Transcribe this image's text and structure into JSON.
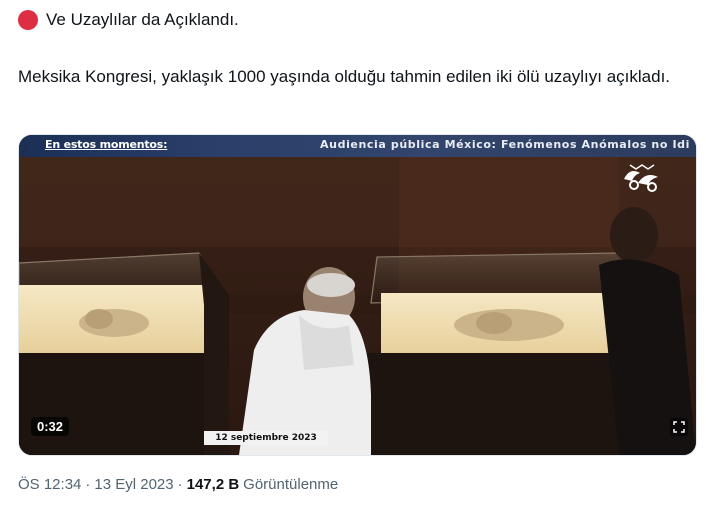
{
  "tweet": {
    "headline": "Ve Uzaylılar da Açıklandı.",
    "body": "Meksika Kongresi, yaklaşık 1000 yaşında olduğu tahmin edilen iki ölü uzaylıyı açıkladı.",
    "accent_color": "#dd2e44"
  },
  "video": {
    "banner_left": "En estos momentos:",
    "banner_right": "Audiencia pública México: Fenómenos Anómalos no Idi",
    "date_caption": "12 septiembre 2023",
    "duration": "0:32",
    "expand_icon": "expand-icon"
  },
  "meta": {
    "time": "ÖS 12:34",
    "separator1": "·",
    "date": "13 Eyl 2023",
    "separator2": "·",
    "views_count": "147,2 B",
    "views_label": "Görüntülenme"
  }
}
